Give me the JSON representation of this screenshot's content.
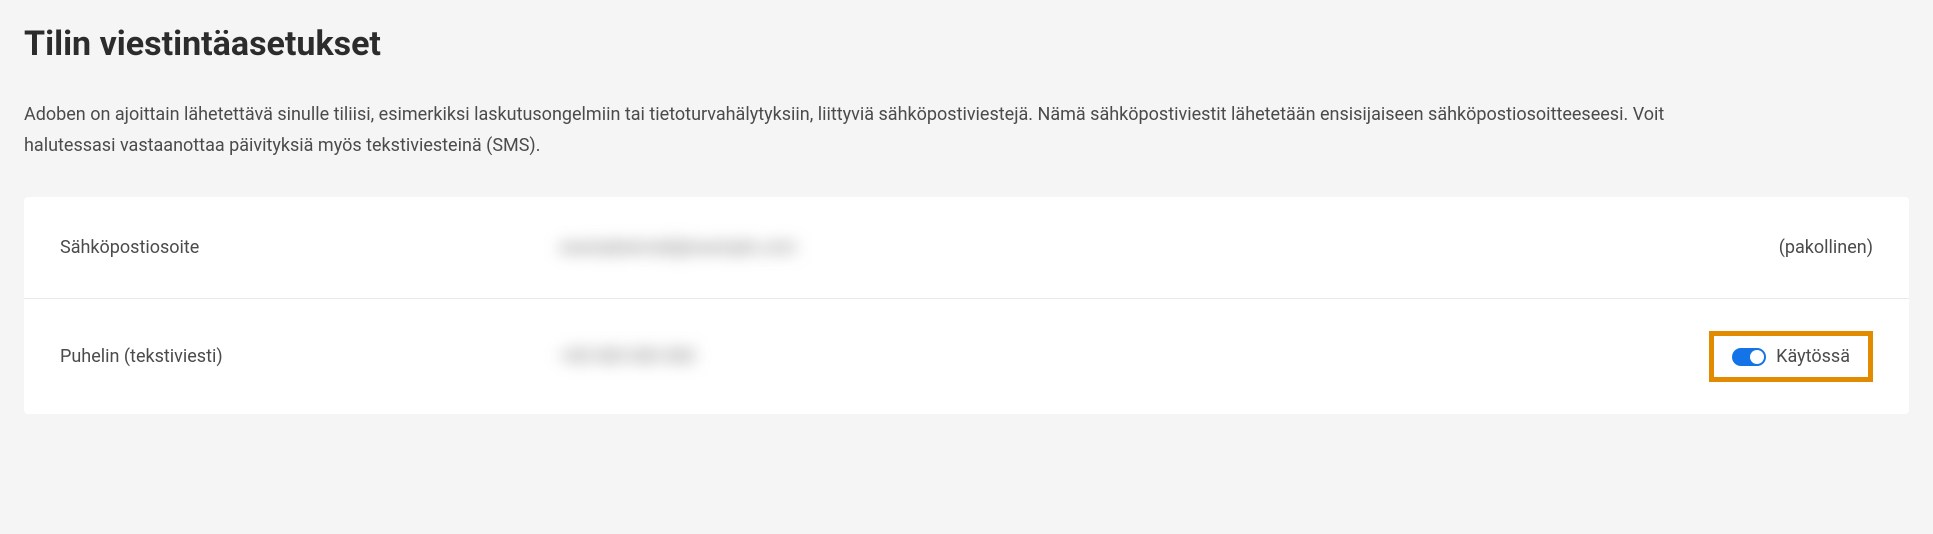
{
  "page": {
    "title": "Tilin viestintäasetukset",
    "description": "Adoben on ajoittain lähetettävä sinulle tiliisi, esimerkiksi laskutusongelmiin tai tietoturvahälytyksiin, liittyviä sähköpostiviestejä. Nämä sähköpostiviestit lähetetään ensisijaiseen sähköpostiosoitteeseesi. Voit halutessasi vastaanottaa päivityksiä myös tekstiviesteinä (SMS)."
  },
  "settings": {
    "email": {
      "label": "Sähköpostiosoite",
      "value": "exampleemail@example.com",
      "status": "(pakollinen)"
    },
    "phone": {
      "label": "Puhelin (tekstiviesti)",
      "value": "+00 000 000 000",
      "toggleOn": true,
      "status": "Käytössä"
    }
  }
}
